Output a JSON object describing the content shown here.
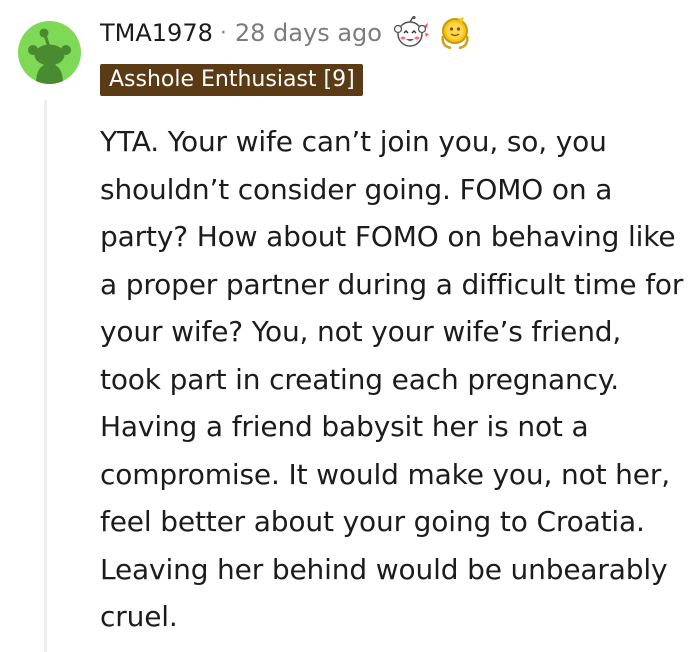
{
  "comment": {
    "username": "TMA1978",
    "separator": "·",
    "timestamp": "28 days ago",
    "flair": "Asshole Enthusiast [9]",
    "body": "YTA. Your wife can’t join you, so, you shouldn’t consider going. FOMO on a party? How about FOMO on behaving like a proper partner during a difficult time for your wife? You, not your wife’s friend, took part in creating each pregnancy. Having a friend babysit her is not a compromise. It would make you, not her, feel better about your going to Croatia. Leaving her behind would be unbearably cruel.",
    "awards": [
      {
        "icon": "wholesome-award-icon"
      },
      {
        "icon": "gold-award-icon"
      }
    ]
  },
  "colors": {
    "avatar_bg": "#7ed957",
    "flair_bg": "#5b3b15",
    "flair_text": "#ffffff",
    "timestamp": "#7c7c7c",
    "thread_line": "#edeff1"
  }
}
